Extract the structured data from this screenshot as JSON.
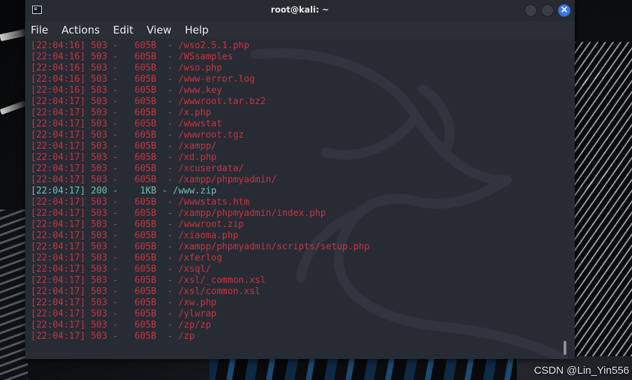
{
  "window": {
    "title": "root@kali: ~",
    "close_glyph": "×"
  },
  "menu": {
    "file": "File",
    "actions": "Actions",
    "edit": "Edit",
    "view": "View",
    "help": "Help"
  },
  "colors": {
    "error_line": "#c8353f",
    "success_line": "#6fc3b1",
    "terminal_bg": "#272b34",
    "close_button": "#3a79e0"
  },
  "icons": {
    "terminal": "terminal-icon",
    "minimize": "minimize-icon",
    "maximize": "maximize-icon",
    "close": "close-icon"
  },
  "output_lines": [
    {
      "text": "[22:04:16] 503 -   605B  - /wso2.5.1.php",
      "status": "err"
    },
    {
      "text": "[22:04:16] 503 -   605B  - /WSsamples",
      "status": "err"
    },
    {
      "text": "[22:04:16] 503 -   605B  - /wso.php",
      "status": "err"
    },
    {
      "text": "[22:04:16] 503 -   605B  - /www-error.log",
      "status": "err"
    },
    {
      "text": "[22:04:16] 503 -   605B  - /www.key",
      "status": "err"
    },
    {
      "text": "[22:04:17] 503 -   605B  - /wwwroot.tar.bz2",
      "status": "err"
    },
    {
      "text": "[22:04:17] 503 -   605B  - /x.php",
      "status": "err"
    },
    {
      "text": "[22:04:17] 503 -   605B  - /wwwstat",
      "status": "err"
    },
    {
      "text": "[22:04:17] 503 -   605B  - /wwwroot.tgz",
      "status": "err"
    },
    {
      "text": "[22:04:17] 503 -   605B  - /xampp/",
      "status": "err"
    },
    {
      "text": "[22:04:17] 503 -   605B  - /xd.php",
      "status": "err"
    },
    {
      "text": "[22:04:17] 503 -   605B  - /xcuserdata/",
      "status": "err"
    },
    {
      "text": "[22:04:17] 503 -   605B  - /xampp/phpmyadmin/",
      "status": "err"
    },
    {
      "text": "[22:04:17] 200 -    1KB - /www.zip",
      "status": "ok"
    },
    {
      "text": "[22:04:17] 503 -   605B  - /wwwstats.htm",
      "status": "err"
    },
    {
      "text": "[22:04:17] 503 -   605B  - /xampp/phpmyadmin/index.php",
      "status": "err"
    },
    {
      "text": "[22:04:17] 503 -   605B  - /wwwroot.zip",
      "status": "err"
    },
    {
      "text": "[22:04:17] 503 -   605B  - /xiaoma.php",
      "status": "err"
    },
    {
      "text": "[22:04:17] 503 -   605B  - /xampp/phpmyadmin/scripts/setup.php",
      "status": "err"
    },
    {
      "text": "[22:04:17] 503 -   605B  - /xferlog",
      "status": "err"
    },
    {
      "text": "[22:04:17] 503 -   605B  - /xsql/",
      "status": "err"
    },
    {
      "text": "[22:04:17] 503 -   605B  - /xsl/_common.xsl",
      "status": "err"
    },
    {
      "text": "[22:04:17] 503 -   605B  - /xsl/common.xsl",
      "status": "err"
    },
    {
      "text": "[22:04:17] 503 -   605B  - /xw.php",
      "status": "err"
    },
    {
      "text": "[22:04:17] 503 -   605B  - /ylwrap",
      "status": "err"
    },
    {
      "text": "[22:04:17] 503 -   605B  - /zp/zp",
      "status": "err"
    },
    {
      "text": "[22:04:17] 503 -   605B  - /zp",
      "status": "err"
    }
  ],
  "watermark": "CSDN @Lin_Yin556"
}
